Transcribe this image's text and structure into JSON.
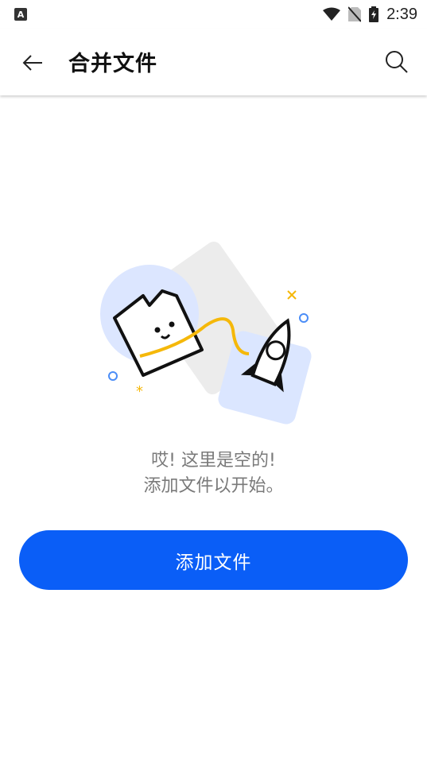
{
  "status_bar": {
    "app_icon_letter": "A",
    "time": "2:39"
  },
  "toolbar": {
    "title": "合并文件"
  },
  "empty_state": {
    "line1": "哎! 这里是空的!",
    "line2": "添加文件以开始。"
  },
  "actions": {
    "add_files_label": "添加文件"
  },
  "colors": {
    "accent": "#0a5ef7",
    "illustration_yellow": "#f5b80a",
    "illustration_blue": "#dbe6ff"
  }
}
